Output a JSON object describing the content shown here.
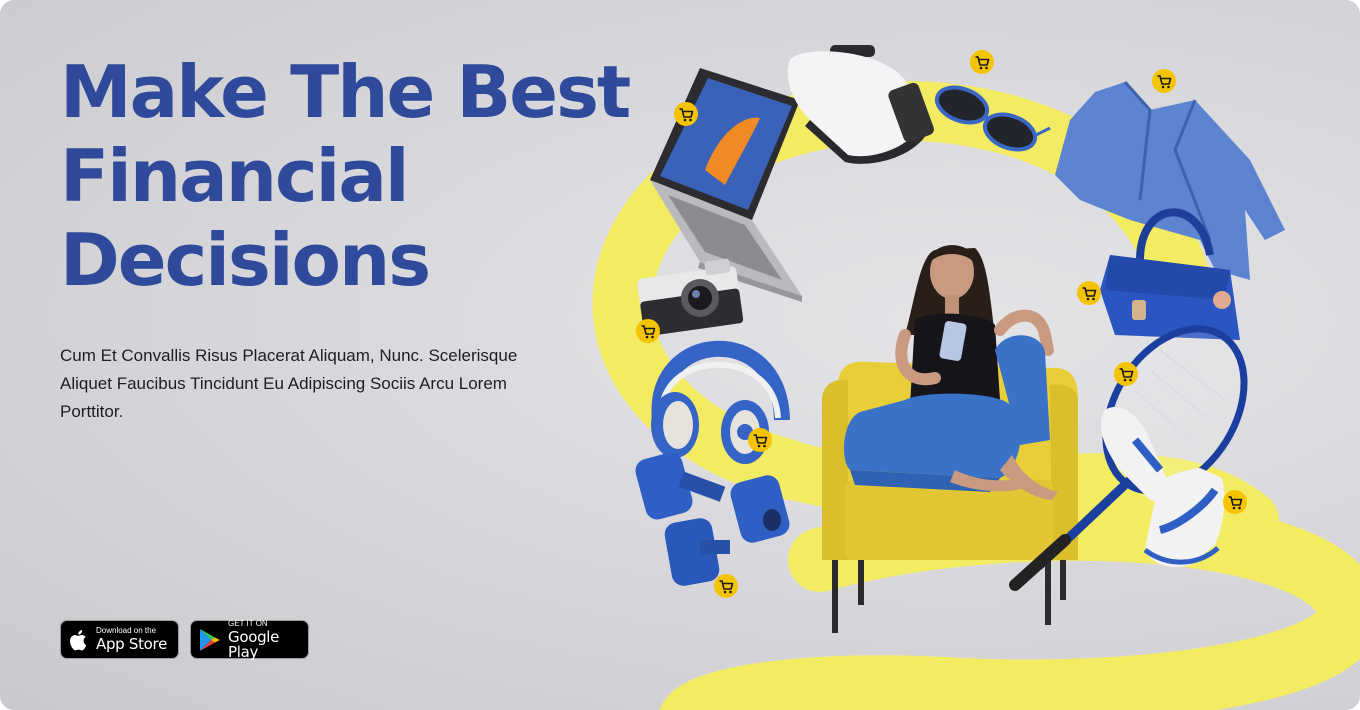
{
  "hero": {
    "headline_lines": [
      "Make The Best",
      "Financial",
      "Decisions"
    ],
    "description": "Cum Et Convallis Risus Placerat Aliquam, Nunc. Scelerisque Aliquet Faucibus Tincidunt Eu Adipiscing Sociis Arcu Lorem Porttitor."
  },
  "badges": {
    "app_store": {
      "small": "Download on the",
      "big": "App Store",
      "icon": "apple-icon"
    },
    "google_play": {
      "small": "GET IT ON",
      "big": "Google Play",
      "icon": "google-play-icon"
    }
  },
  "illustration": {
    "products": [
      "laptop",
      "vr-headset",
      "sunglasses",
      "jacket",
      "handbag",
      "camera",
      "headphones",
      "dumbbells",
      "tennis-racket",
      "sneakers",
      "armchair"
    ],
    "cart_badge_icon": "shopping-cart-icon"
  },
  "colors": {
    "headline": "#2f4a9a",
    "accent_yellow": "#f3ec63",
    "product_blue": "#2f5fc4",
    "cart_badge": "#f5c400",
    "background": "#d6d6da"
  }
}
